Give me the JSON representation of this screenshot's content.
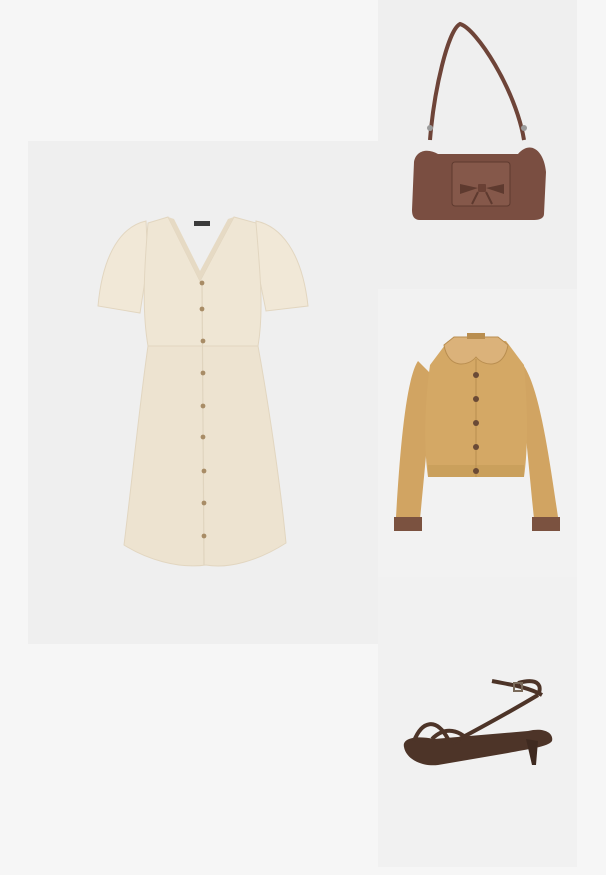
{
  "outfit": {
    "items": [
      {
        "key": "dress",
        "icon": "dress-icon",
        "color": "#efe6d4",
        "button_color": "#a88c66"
      },
      {
        "key": "bag",
        "icon": "bag-icon",
        "color": "#7a4e41"
      },
      {
        "key": "jacket",
        "icon": "jacket-icon",
        "color": "#d4a865",
        "cuff_color": "#7b5240"
      },
      {
        "key": "sandal",
        "icon": "sandal-icon",
        "color": "#4d3428"
      }
    ],
    "background_color": "#f6f6f6",
    "tile_color": "#efefef"
  }
}
